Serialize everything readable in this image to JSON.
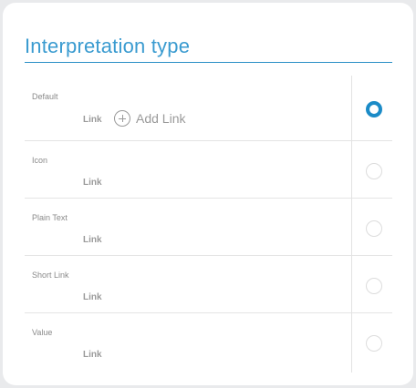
{
  "title": "Interpretation type",
  "options": [
    {
      "label": "Default",
      "value": "Link",
      "selected": true
    },
    {
      "label": "Icon",
      "value": "Link",
      "selected": false
    },
    {
      "label": "Plain Text",
      "value": "Link",
      "selected": false
    },
    {
      "label": "Short Link",
      "value": "Link",
      "selected": false
    },
    {
      "label": "Value",
      "value": "Link",
      "selected": false
    }
  ],
  "add_link_label": "Add Link",
  "colors": {
    "accent": "#1b8bc7",
    "title": "#3a9bd0",
    "muted": "#9a9a9a"
  }
}
